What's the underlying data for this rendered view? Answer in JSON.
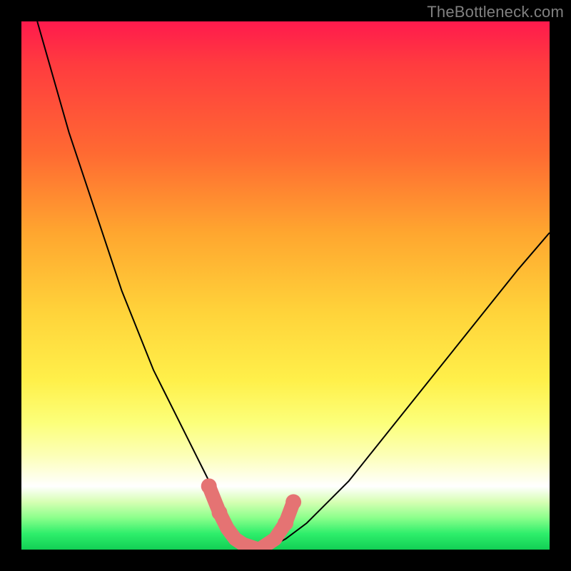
{
  "watermark": "TheBottleneck.com",
  "colors": {
    "background": "#000000",
    "curve": "#000000",
    "overlay": "#e57373",
    "gradient_stops": [
      "#ff1a4d",
      "#ff3b3f",
      "#ff6a32",
      "#ffa62f",
      "#ffd33a",
      "#fff04a",
      "#fcff7a",
      "#fcffb5",
      "#ffffff",
      "#d6ffb3",
      "#8bff8b",
      "#2eee6b",
      "#12cf55"
    ]
  },
  "chart_data": {
    "type": "line",
    "title": "",
    "xlabel": "",
    "ylabel": "",
    "xlim": [
      0,
      100
    ],
    "ylim": [
      0,
      100
    ],
    "legend": false,
    "series": [
      {
        "name": "bottleneck-curve",
        "x": [
          3,
          5,
          7,
          9,
          11,
          13,
          15,
          17,
          19,
          21,
          23,
          25,
          27,
          29,
          31,
          33,
          34.5,
          36,
          37.5,
          38.5,
          39.5,
          41,
          43,
          46,
          50,
          54,
          58,
          62,
          66,
          70,
          74,
          78,
          82,
          86,
          90,
          94,
          100
        ],
        "y": [
          100,
          93,
          86,
          79,
          73,
          67,
          61,
          55,
          49,
          44,
          39,
          34,
          30,
          26,
          22,
          18,
          15,
          12,
          9,
          6,
          3,
          1,
          0,
          0,
          2,
          5,
          9,
          13,
          18,
          23,
          28,
          33,
          38,
          43,
          48,
          53,
          60
        ]
      }
    ],
    "overlay": {
      "name": "match-region",
      "x": [
        35.5,
        37.5,
        39,
        40.5,
        42,
        45,
        48,
        50,
        51.5
      ],
      "y": [
        12,
        7,
        4,
        2,
        1,
        0,
        2,
        5,
        9
      ]
    },
    "gradient_meaning": "red=high bottleneck, green=optimal match; y encodes mismatch magnitude"
  }
}
